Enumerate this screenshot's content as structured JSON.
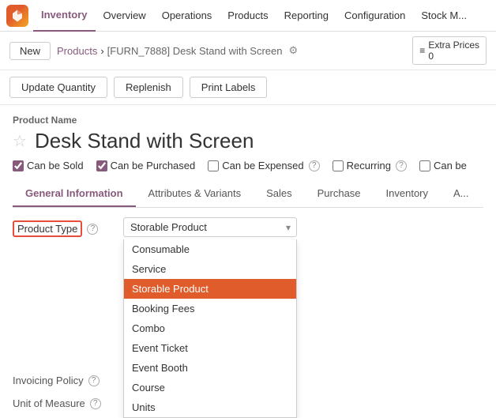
{
  "nav": {
    "logo_label": "Odoo",
    "items": [
      {
        "label": "Inventory",
        "active": true
      },
      {
        "label": "Overview",
        "active": false
      },
      {
        "label": "Operations",
        "active": false
      },
      {
        "label": "Products",
        "active": false
      },
      {
        "label": "Reporting",
        "active": false
      },
      {
        "label": "Configuration",
        "active": false
      },
      {
        "label": "Stock M...",
        "active": false
      }
    ]
  },
  "breadcrumb": {
    "new_label": "New",
    "parent_label": "Products",
    "current_label": "[FURN_7888] Desk Stand with Screen",
    "extra_prices_label": "Extra Prices",
    "extra_prices_count": "0"
  },
  "actions": {
    "update_quantity": "Update Quantity",
    "replenish": "Replenish",
    "print_labels": "Print Labels"
  },
  "product": {
    "name_label": "Product Name",
    "name": "Desk Stand with Screen",
    "checkboxes": [
      {
        "label": "Can be Sold",
        "checked": true
      },
      {
        "label": "Can be Purchased",
        "checked": true
      },
      {
        "label": "Can be Expensed",
        "checked": false
      },
      {
        "label": "Recurring",
        "checked": false
      },
      {
        "label": "Can be",
        "checked": false
      }
    ]
  },
  "tabs": [
    {
      "label": "General Information",
      "active": true
    },
    {
      "label": "Attributes & Variants",
      "active": false
    },
    {
      "label": "Sales",
      "active": false
    },
    {
      "label": "Purchase",
      "active": false
    },
    {
      "label": "Inventory",
      "active": false
    },
    {
      "label": "A...",
      "active": false
    }
  ],
  "form": {
    "product_type_label": "Product Type",
    "product_type_value": "Storable Product",
    "invoicing_policy_label": "Invoicing Policy",
    "unit_of_measure_label": "Unit of Measure",
    "dropdown_items": [
      {
        "label": "Consumable",
        "selected": false
      },
      {
        "label": "Service",
        "selected": false
      },
      {
        "label": "Storable Product",
        "selected": true
      },
      {
        "label": "Booking Fees",
        "selected": false
      },
      {
        "label": "Combo",
        "selected": false
      },
      {
        "label": "Event Ticket",
        "selected": false
      },
      {
        "label": "Event Booth",
        "selected": false
      },
      {
        "label": "Course",
        "selected": false
      },
      {
        "label": "Units",
        "selected": false
      }
    ]
  }
}
